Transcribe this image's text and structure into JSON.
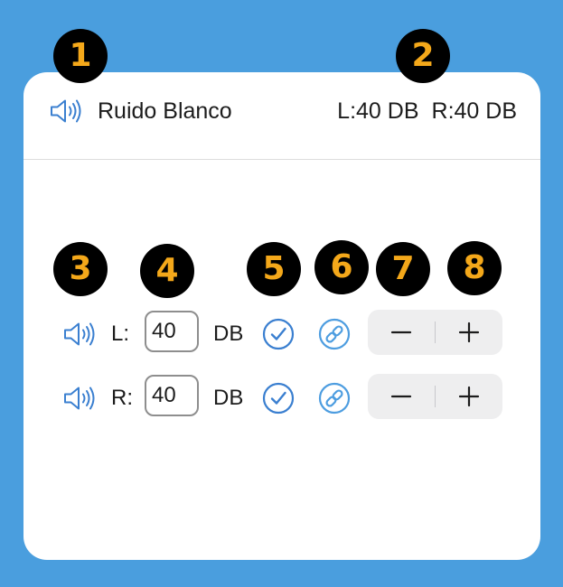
{
  "header": {
    "title": "Ruido Blanco",
    "left_level": "L:40 DB",
    "right_level": "R:40 DB"
  },
  "badges": [
    "1",
    "2",
    "3",
    "4",
    "5",
    "6",
    "7",
    "8"
  ],
  "channels": [
    {
      "label": "L:",
      "value": "40",
      "unit": "DB"
    },
    {
      "label": "R:",
      "value": "40",
      "unit": "DB"
    }
  ],
  "icons": {
    "speaker": "speaker-wave-icon",
    "confirm": "checkmark-circle-icon",
    "link": "link-circle-icon",
    "minus": "minus-icon",
    "plus": "plus-icon"
  },
  "colors": {
    "background": "#4a9ede",
    "accent": "#3a7fd0",
    "badge_fill": "#000000",
    "badge_text": "#f4a81a",
    "stepper_bg": "#eeeeef"
  }
}
